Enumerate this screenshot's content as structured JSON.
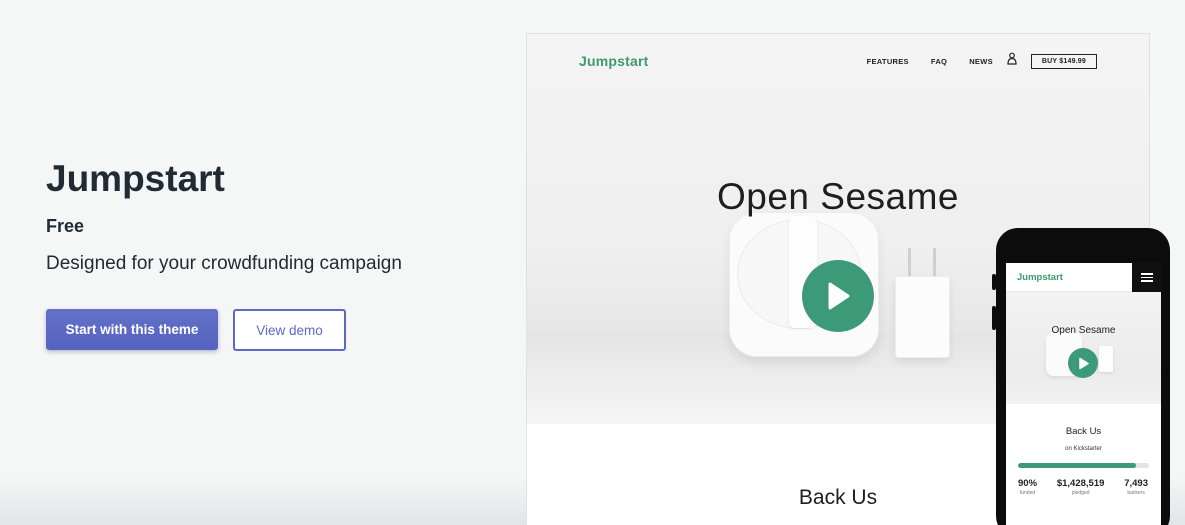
{
  "theme": {
    "name": "Jumpstart",
    "price": "Free",
    "description": "Designed for your crowdfunding campaign",
    "primary_button": "Start with this theme",
    "secondary_button": "View demo"
  },
  "desktop_preview": {
    "logo": "Jumpstart",
    "nav": [
      "FEATURES",
      "FAQ",
      "NEWS"
    ],
    "buy_button": "BUY $149.99",
    "hero_heading": "Open Sesame",
    "section_heading": "Back Us"
  },
  "mobile_preview": {
    "logo": "Jumpstart",
    "hero_heading": "Open Sesame",
    "section_heading": "Back Us",
    "subheading": "on Kickstarter",
    "progress_fraction": 0.9,
    "stats": [
      {
        "value": "90%",
        "label": "funded"
      },
      {
        "value": "$1,428,519",
        "label": "pledged"
      },
      {
        "value": "7,493",
        "label": "backers"
      }
    ]
  },
  "colors": {
    "brand_green": "#3d9a78",
    "primary_purple": "#5c6ac4"
  },
  "icons": [
    "user-icon",
    "play-icon",
    "hamburger-menu-icon"
  ]
}
